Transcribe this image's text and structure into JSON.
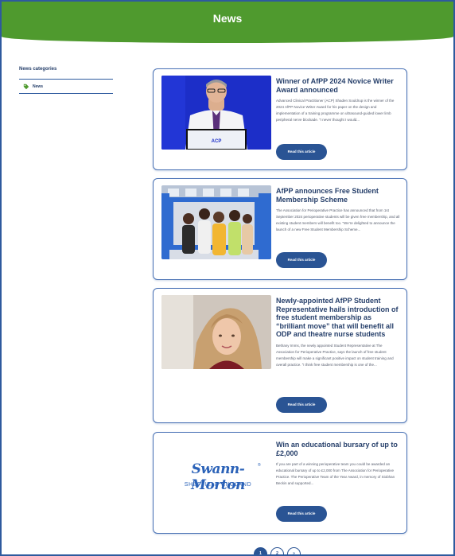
{
  "header": {
    "title": "News"
  },
  "sidebar": {
    "title": "News categories",
    "items": [
      {
        "label": "News",
        "icon": "tag-icon"
      }
    ]
  },
  "colors": {
    "header_green": "#4f9a2e",
    "primary_blue": "#2a5494",
    "title_navy": "#27406b"
  },
  "articles": [
    {
      "title": "Winner of AfPP 2024 Novice Writer Award announced",
      "excerpt": "Advanced Clinical Practitioner (ACP) Shaden Souldrup is the winner of the 2024 AfPP Novice Writer Award for his paper on the design and implementation of a training programme on ultrasound-guided lower limb peripheral nerve blockade. “I never thought I would...",
      "button": "Read this article"
    },
    {
      "title": "AfPP announces Free Student Membership Scheme",
      "excerpt": "The Association for Perioperative Practice has announced that from 1st September 2024 perioperative students will be given free membership, and all existing student members will benefit too. “We’re delighted to announce the launch of a new Free Student Membership Scheme...",
      "button": "Read this article"
    },
    {
      "title": "Newly-appointed AfPP Student Representative hails introduction of free student membership as “brilliant move” that will benefit all ODP and theatre nurse students",
      "excerpt": "Bethany Imms, the newly appointed Student Representative at The Association for Perioperative Practice, says the launch of free student membership will make a significant positive impact on student training and overall practice. “I think free student membership is one of the...",
      "button": "Read this article"
    },
    {
      "title": "Win an educational bursary of up to £2,000",
      "excerpt": "If you are part of a winning perioperative team you could be awarded an educational bursary of up to £2,000 from The Association for Perioperative Practice. The Perioperative Team of the Year Award, in memory of Siobhan Beckin and supported...",
      "button": "Read this article",
      "logo": {
        "line1": "Swann-Morton",
        "line2": "SHEFFIELD ENGLAND",
        "mark": "®"
      }
    }
  ],
  "pagination": {
    "pages": [
      "1",
      "2",
      "»"
    ],
    "active": "1"
  }
}
